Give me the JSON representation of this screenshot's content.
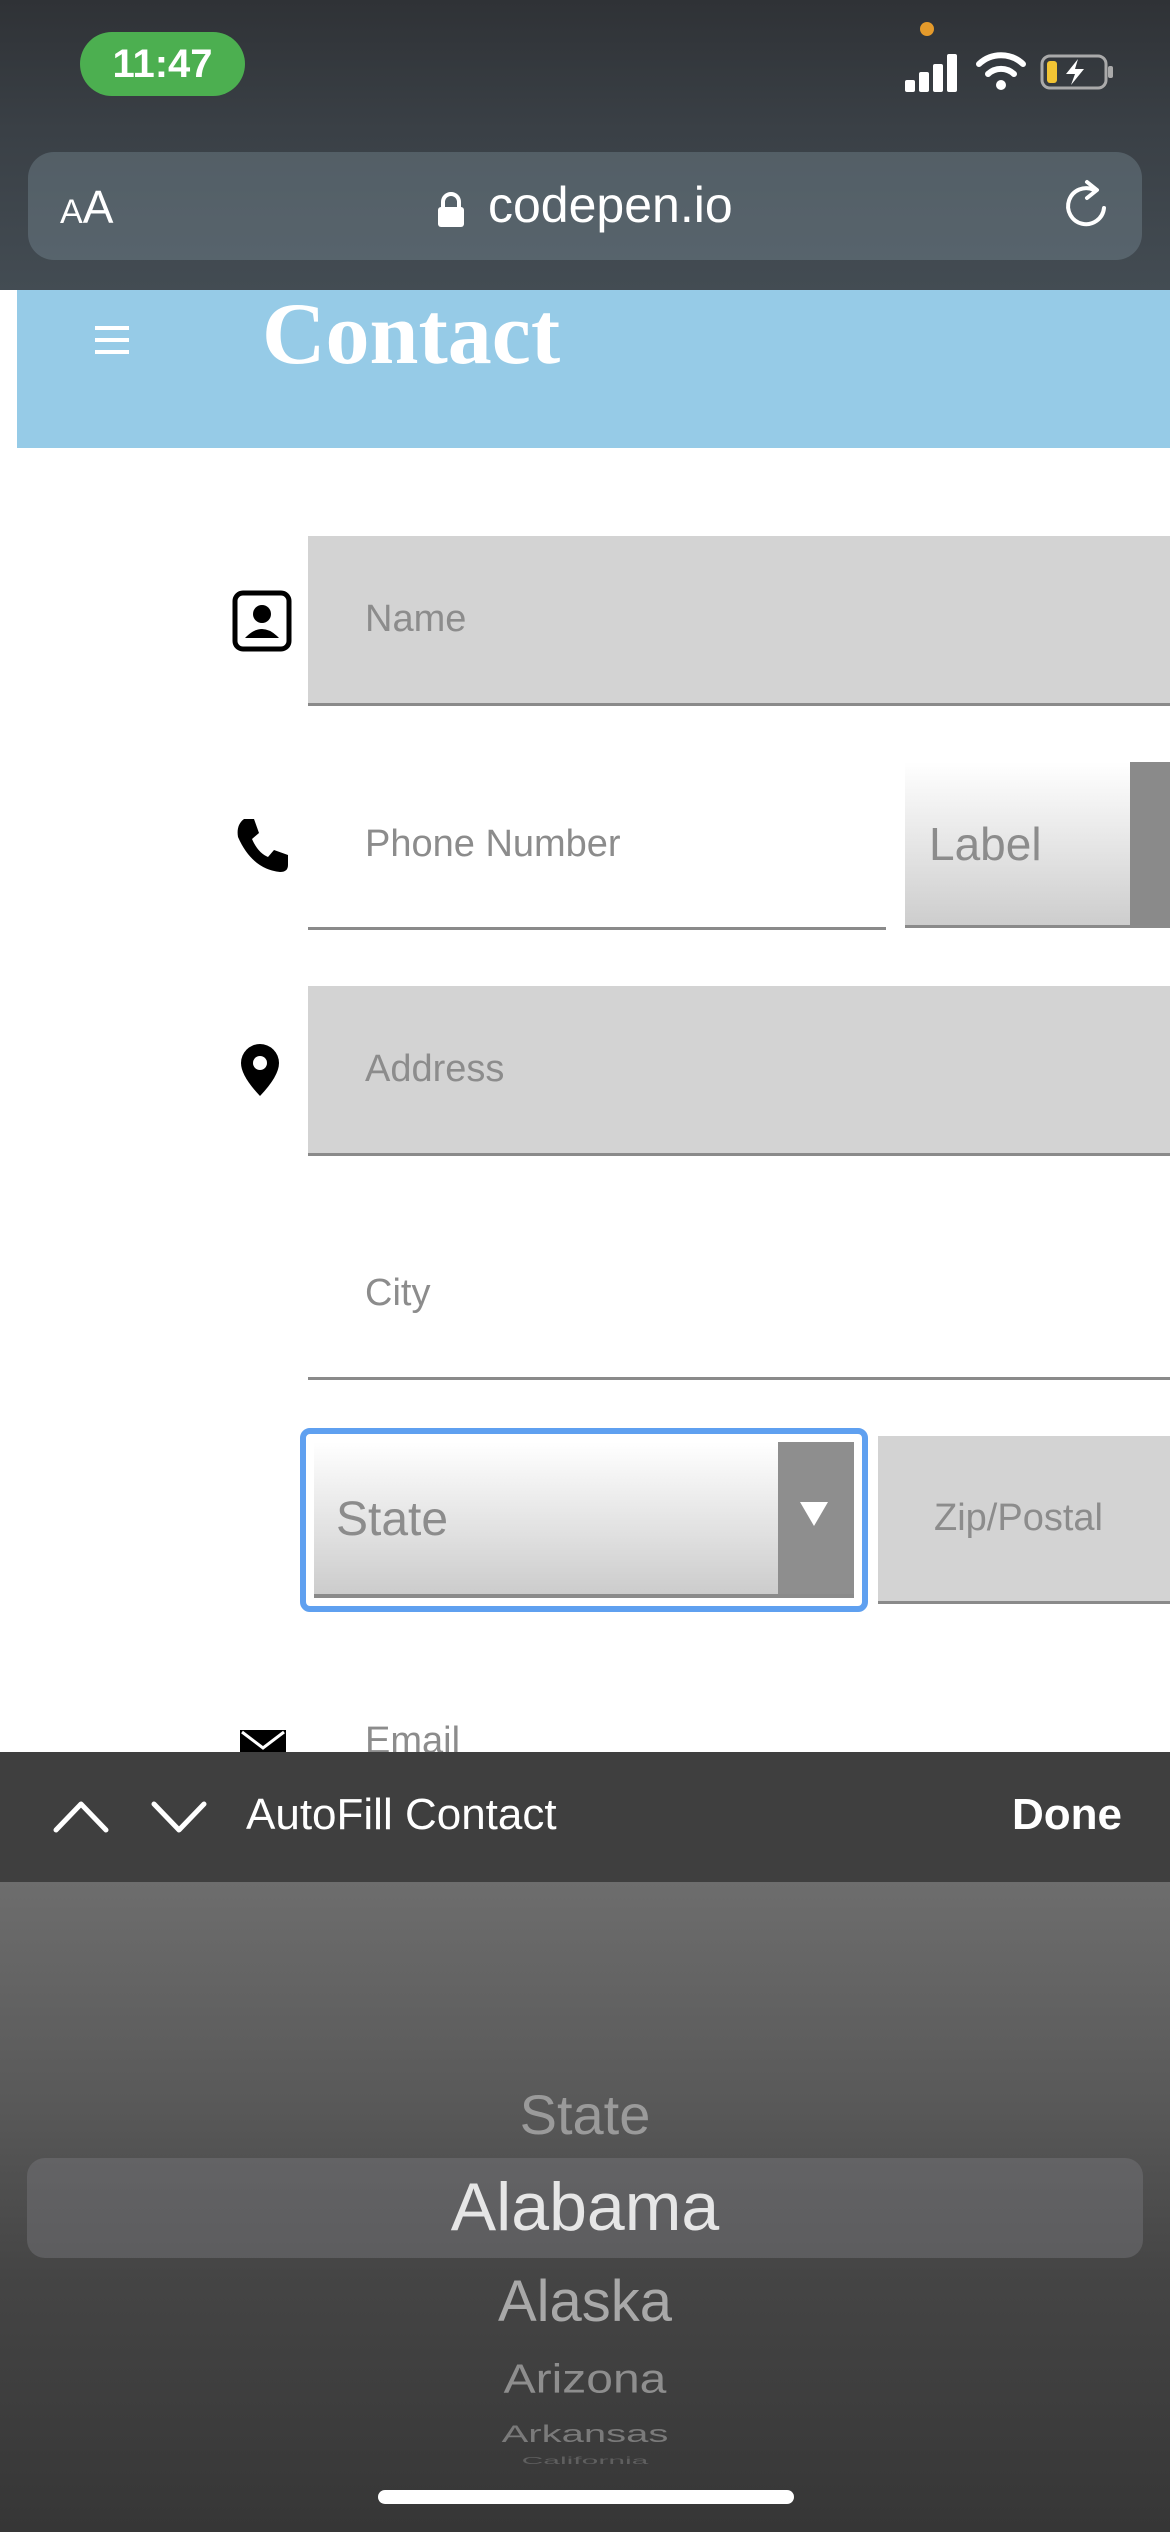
{
  "status_bar": {
    "time": "11:47"
  },
  "browser": {
    "text_size_label": "AA",
    "domain": "codepen.io"
  },
  "page": {
    "title": "Contact"
  },
  "form": {
    "name_placeholder": "Name",
    "phone_placeholder": "Phone Number",
    "phone_label_select": "Label",
    "address_placeholder": "Address",
    "city_placeholder": "City",
    "state_select": "State",
    "zip_placeholder": "Zip/Postal",
    "email_placeholder": "Email"
  },
  "accessory": {
    "autofill": "AutoFill Contact",
    "done": "Done"
  },
  "picker": {
    "items": [
      "State",
      "Alabama",
      "Alaska",
      "Arizona",
      "Arkansas",
      "California"
    ],
    "selected": "Alabama"
  }
}
